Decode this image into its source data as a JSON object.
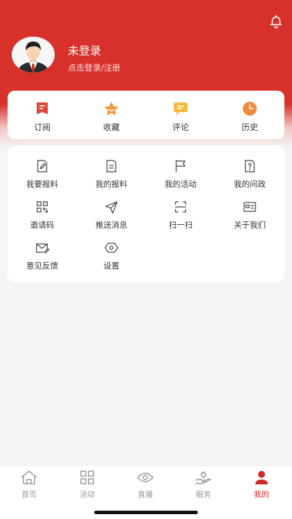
{
  "colors": {
    "primary": "#d8302a",
    "background": "#f5f5f5",
    "card": "#ffffff",
    "icon_gray": "#555555"
  },
  "profile": {
    "name": "未登录",
    "subtitle": "点击登录/注册",
    "avatar_icon": "user-avatar-icon"
  },
  "header": {
    "bell_icon": "bell-icon"
  },
  "quick_actions": [
    {
      "label": "订阅",
      "icon": "subscribe-icon"
    },
    {
      "label": "收藏",
      "icon": "favorite-star-icon"
    },
    {
      "label": "评论",
      "icon": "comment-icon"
    },
    {
      "label": "历史",
      "icon": "history-clock-icon"
    }
  ],
  "menu": [
    {
      "label": "我要报料",
      "icon": "edit-doc-icon"
    },
    {
      "label": "我的报料",
      "icon": "doc-list-icon"
    },
    {
      "label": "我的活动",
      "icon": "flag-icon"
    },
    {
      "label": "我的问政",
      "icon": "question-doc-icon"
    },
    {
      "label": "邀请码",
      "icon": "qr-code-icon"
    },
    {
      "label": "推送消息",
      "icon": "send-icon"
    },
    {
      "label": "扫一扫",
      "icon": "scan-icon"
    },
    {
      "label": "关于我们",
      "icon": "id-card-icon"
    },
    {
      "label": "意见反馈",
      "icon": "feedback-mail-icon"
    },
    {
      "label": "设置",
      "icon": "settings-hex-icon"
    }
  ],
  "tabs": [
    {
      "label": "首页",
      "icon": "home-icon",
      "active": false
    },
    {
      "label": "活动",
      "icon": "grid-icon",
      "active": false
    },
    {
      "label": "直播",
      "icon": "live-eye-icon",
      "active": false
    },
    {
      "label": "服务",
      "icon": "service-hand-icon",
      "active": false
    },
    {
      "label": "我的",
      "icon": "profile-icon",
      "active": true
    }
  ]
}
